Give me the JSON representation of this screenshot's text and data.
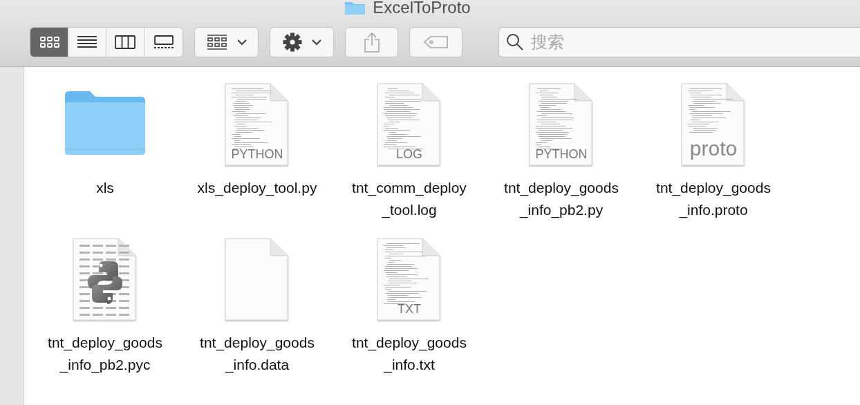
{
  "window": {
    "title": "ExcelToProto"
  },
  "toolbar": {
    "view_modes": [
      {
        "kind": "icons",
        "selected": true
      },
      {
        "kind": "list",
        "selected": false
      },
      {
        "kind": "columns",
        "selected": false
      },
      {
        "kind": "gallery",
        "selected": false
      }
    ],
    "search": {
      "placeholder": "搜索"
    }
  },
  "files": [
    {
      "kind": "folder",
      "lines": [
        "xls"
      ]
    },
    {
      "kind": "document",
      "badge": "PYTHON",
      "lines": [
        "xls_deploy_tool.py"
      ]
    },
    {
      "kind": "document",
      "badge": "LOG",
      "lines": [
        "tnt_comm_deploy",
        "_tool.log"
      ]
    },
    {
      "kind": "document",
      "badge": "PYTHON",
      "lines": [
        "tnt_deploy_goods",
        "_info_pb2.py"
      ]
    },
    {
      "kind": "document",
      "badge": "proto",
      "lines": [
        "tnt_deploy_goods",
        "_info.proto"
      ]
    },
    {
      "kind": "compiled",
      "lines": [
        "tnt_deploy_goods",
        "_info_pb2.pyc"
      ]
    },
    {
      "kind": "blank",
      "lines": [
        "tnt_deploy_goods",
        "_info.data"
      ]
    },
    {
      "kind": "document",
      "badge": "TXT",
      "lines": [
        "tnt_deploy_goods",
        "_info.txt"
      ]
    }
  ]
}
